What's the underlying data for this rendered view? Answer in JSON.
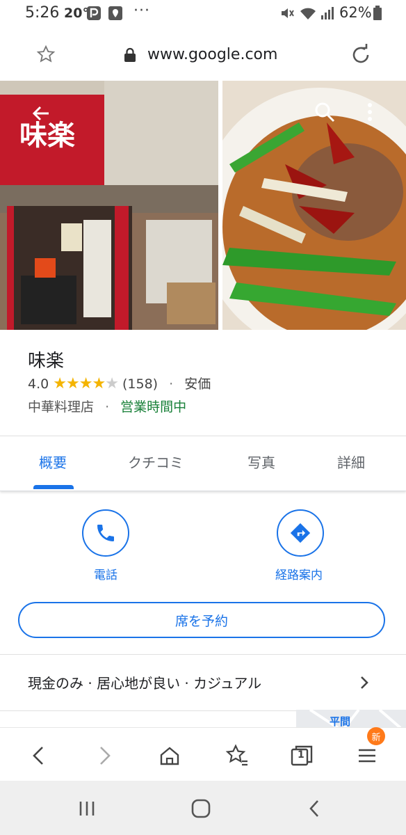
{
  "status_bar": {
    "time": "5:26",
    "temperature": "20°",
    "more_dots": "···",
    "battery_percent": "62%",
    "icons": [
      "pay-icon",
      "map-pin-icon",
      "mute-icon",
      "wifi-icon",
      "signal-icon",
      "battery-icon"
    ]
  },
  "url_bar": {
    "url": "www.google.com",
    "icons": [
      "star-icon",
      "lock-icon",
      "reload-icon"
    ]
  },
  "photos": {
    "left_sign_text": "味楽",
    "icons": [
      "back-arrow-icon",
      "search-icon",
      "more-vert-icon"
    ]
  },
  "place": {
    "name": "味楽",
    "rating": "4.0",
    "stars_filled": 4,
    "reviews": "(158)",
    "price": "安価",
    "category": "中華料理店",
    "status": "営業時間中",
    "status_color": "#188038",
    "separator": "·"
  },
  "tabs": {
    "overview": "概要",
    "reviews": "クチコミ",
    "photos": "写真",
    "details": "詳細",
    "active": "overview"
  },
  "actions": {
    "call": "電話",
    "directions": "経路案内",
    "reserve": "席を予約",
    "accent_color": "#1a73e8"
  },
  "attributes": {
    "text": "現金のみ · 居心地が良い · カジュアル"
  },
  "map_peek": {
    "label": "平間"
  },
  "toolbar": {
    "badge": "新",
    "tab_count": "1",
    "badge_color": "#ff7a1a"
  }
}
